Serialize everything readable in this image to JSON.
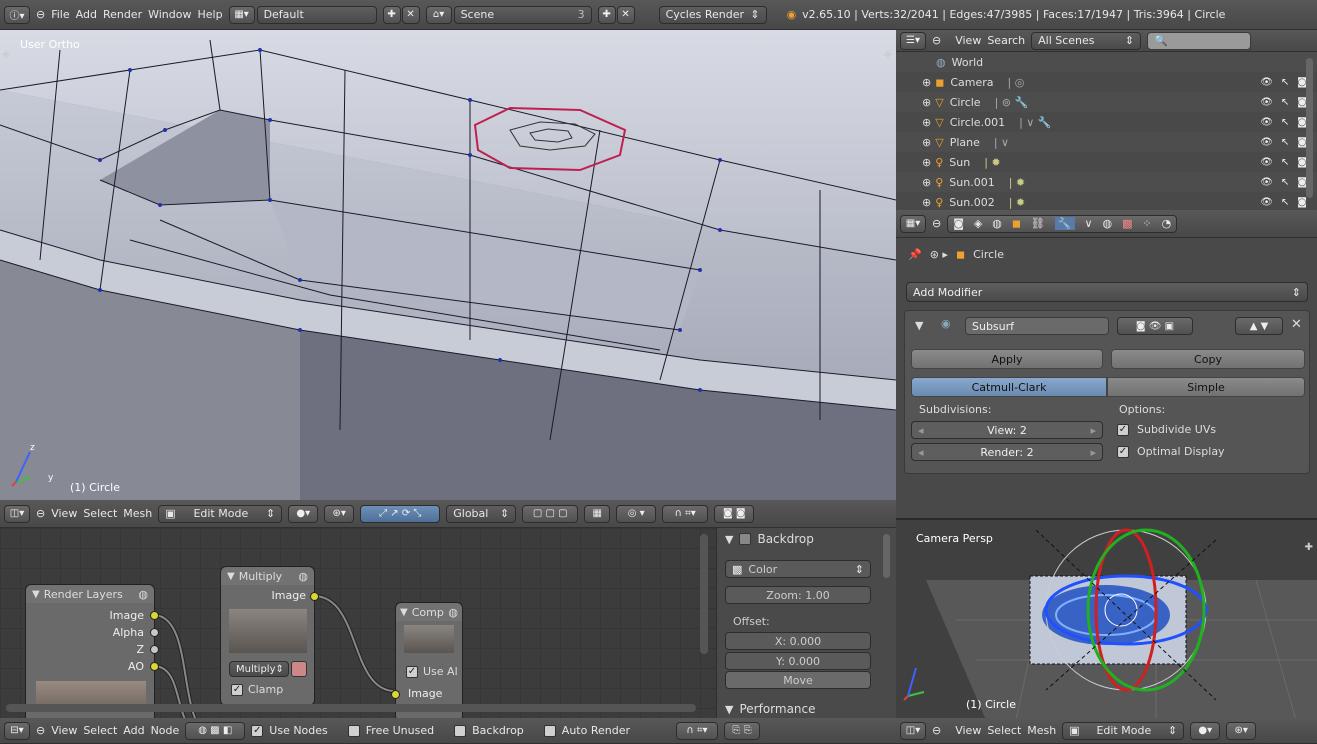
{
  "top_header": {
    "menus": [
      "File",
      "Add",
      "Render",
      "Window",
      "Help"
    ],
    "layout": "Default",
    "scene": "Scene",
    "scene_users": "3",
    "engine": "Cycles Render",
    "stats": "v2.65.10 | Verts:32/2041 | Edges:47/3985 | Faces:17/1947 | Tris:3964 | Circle"
  },
  "viewport_main": {
    "view_label": "User Ortho",
    "object_label": "(1) Circle",
    "axis_z": "z",
    "axis_y": "y",
    "header": {
      "menus": [
        "View",
        "Select",
        "Mesh"
      ],
      "mode": "Edit Mode",
      "orientation": "Global"
    }
  },
  "outliner": {
    "menus": [
      "View",
      "Search"
    ],
    "filter": "All Scenes",
    "items": [
      "World",
      "Camera",
      "Circle",
      "Circle.001",
      "Plane",
      "Sun",
      "Sun.001",
      "Sun.002"
    ]
  },
  "properties": {
    "breadcrumb_object": "Circle",
    "add_modifier": "Add Modifier",
    "modifier_name": "Subsurf",
    "apply": "Apply",
    "copy": "Copy",
    "tab_catmull": "Catmull-Clark",
    "tab_simple": "Simple",
    "subdivisions_label": "Subdivisions:",
    "view_field": "View: 2",
    "render_field": "Render: 2",
    "options_label": "Options:",
    "opt_subdivide_uvs": "Subdivide UVs",
    "opt_optimal_display": "Optimal Display"
  },
  "node_editor": {
    "render_layers": {
      "title": "Render Layers",
      "outputs": [
        "Image",
        "Alpha",
        "Z",
        "AO"
      ]
    },
    "multiply": {
      "title": "Multiply",
      "output": "Image",
      "blend": "Multiply",
      "clamp": "Clamp"
    },
    "comp": {
      "title": "Comp",
      "use_alpha": "Use Al",
      "input": "Image"
    },
    "sidebar": {
      "backdrop": "Backdrop",
      "color": "Color",
      "zoom": "Zoom: 1.00",
      "offset": "Offset:",
      "x": "X: 0.000",
      "y": "Y: 0.000",
      "move": "Move",
      "performance": "Performance"
    },
    "header": {
      "menus": [
        "View",
        "Select",
        "Add",
        "Node"
      ],
      "use_nodes": "Use Nodes",
      "free_unused": "Free Unused",
      "backdrop": "Backdrop",
      "auto_render": "Auto Render"
    }
  },
  "camera_view": {
    "label": "Camera Persp",
    "object_label": "(1) Circle",
    "header": {
      "menus": [
        "View",
        "Select",
        "Mesh"
      ],
      "mode": "Edit Mode"
    }
  }
}
